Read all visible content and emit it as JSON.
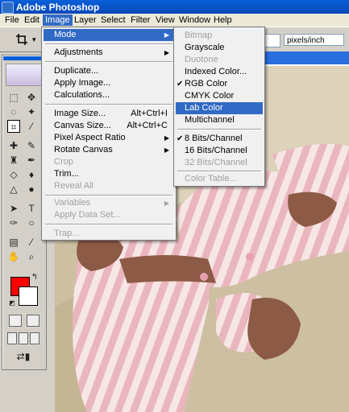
{
  "app": {
    "title": "Adobe Photoshop"
  },
  "menubar": {
    "items": [
      "File",
      "Edit",
      "Image",
      "Layer",
      "Select",
      "Filter",
      "View",
      "Window",
      "Help"
    ]
  },
  "options": {
    "unit": "pixels/inch"
  },
  "image_menu": {
    "mode": "Mode",
    "adjustments": "Adjustments",
    "duplicate": "Duplicate...",
    "apply_image": "Apply Image...",
    "calculations": "Calculations...",
    "image_size": "Image Size...",
    "image_size_sc": "Alt+Ctrl+I",
    "canvas_size": "Canvas Size...",
    "canvas_size_sc": "Alt+Ctrl+C",
    "pixel_aspect": "Pixel Aspect Ratio",
    "rotate_canvas": "Rotate Canvas",
    "crop": "Crop",
    "trim": "Trim...",
    "reveal_all": "Reveal All",
    "variables": "Variables",
    "apply_data_set": "Apply Data Set...",
    "trap": "Trap..."
  },
  "mode_menu": {
    "bitmap": "Bitmap",
    "grayscale": "Grayscale",
    "duotone": "Duotone",
    "indexed": "Indexed Color...",
    "rgb": "RGB Color",
    "cmyk": "CMYK Color",
    "lab": "Lab Color",
    "multichannel": "Multichannel",
    "bits8": "8 Bits/Channel",
    "bits16": "16 Bits/Channel",
    "bits32": "32 Bits/Channel",
    "color_table": "Color Table..."
  },
  "colors": {
    "foreground": "#ff0000",
    "background": "#ffffff",
    "highlight": "#316ac5"
  }
}
